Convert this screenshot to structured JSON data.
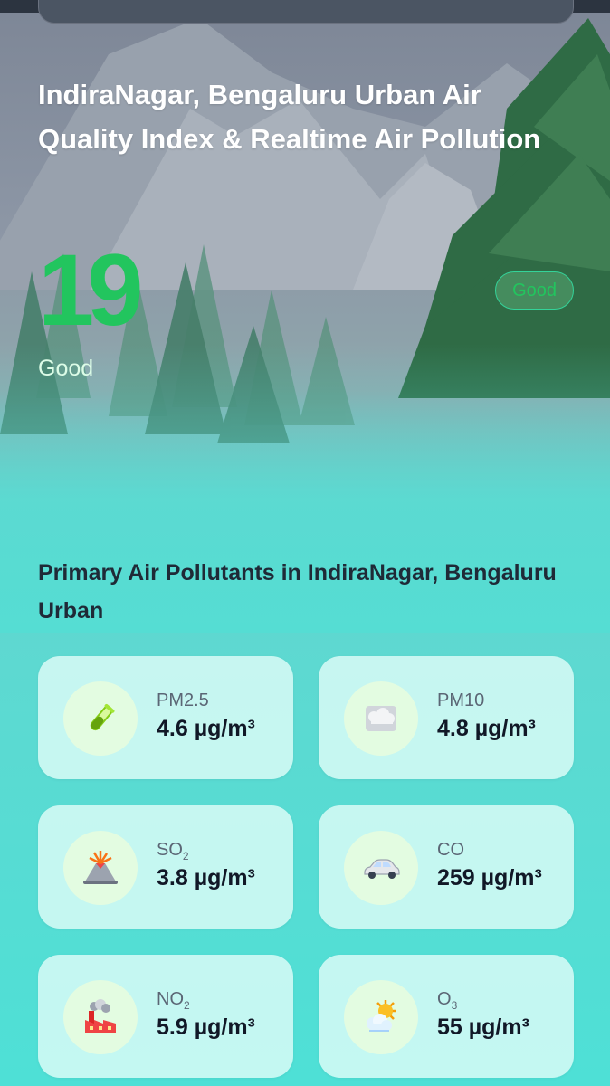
{
  "hero": {
    "title": "IndiraNagar, Bengaluru Urban Air Quality Index & Realtime Air Pollution",
    "aqi_value": "19",
    "aqi_badge": "Good",
    "aqi_label": "Good"
  },
  "colors": {
    "aqi_green": "#22c55e",
    "teal_background": "#4fdcd3",
    "card_background": "#dcfcf8"
  },
  "pollutants_section": {
    "title": "Primary Air Pollutants in IndiraNagar, Bengaluru Urban",
    "items": [
      {
        "name": "PM2.5",
        "formula_main": "PM2.5",
        "formula_sub": "",
        "value": "4.6 µg/m³",
        "icon": "test-tube-icon"
      },
      {
        "name": "PM10",
        "formula_main": "PM10",
        "formula_sub": "",
        "value": "4.8 µg/m³",
        "icon": "fog-icon"
      },
      {
        "name": "SO2",
        "formula_main": "SO",
        "formula_sub": "2",
        "value": "3.8 µg/m³",
        "icon": "volcano-icon"
      },
      {
        "name": "CO",
        "formula_main": "CO",
        "formula_sub": "",
        "value": "259 µg/m³",
        "icon": "car-icon"
      },
      {
        "name": "NO2",
        "formula_main": "NO",
        "formula_sub": "2",
        "value": "5.9 µg/m³",
        "icon": "factory-icon"
      },
      {
        "name": "O3",
        "formula_main": "O",
        "formula_sub": "3",
        "value": "55 µg/m³",
        "icon": "sun-cloud-icon"
      }
    ]
  }
}
